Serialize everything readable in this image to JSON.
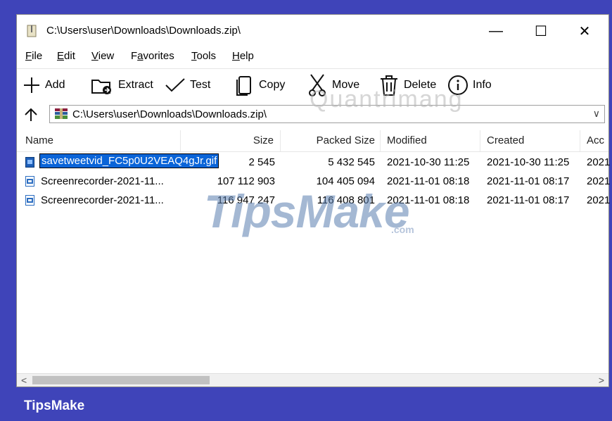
{
  "window": {
    "title": "C:\\Users\\user\\Downloads\\Downloads.zip\\",
    "minimize": "—",
    "maximize": "☐",
    "close": "✕"
  },
  "menu": [
    {
      "pre": "",
      "u": "F",
      "post": "ile"
    },
    {
      "pre": "",
      "u": "E",
      "post": "dit"
    },
    {
      "pre": "",
      "u": "V",
      "post": "iew"
    },
    {
      "pre": "F",
      "u": "a",
      "post": "vorites"
    },
    {
      "pre": "",
      "u": "T",
      "post": "ools"
    },
    {
      "pre": "",
      "u": "H",
      "post": "elp"
    }
  ],
  "toolbar": {
    "add": "Add",
    "extract": "Extract",
    "test": "Test",
    "copy": "Copy",
    "move": "Move",
    "delete": "Delete",
    "info": "Info"
  },
  "address": {
    "path": "C:\\Users\\user\\Downloads\\Downloads.zip\\",
    "chevron": "∨"
  },
  "columns": [
    "Name",
    "Size",
    "Packed Size",
    "Modified",
    "Created",
    "Acc"
  ],
  "rows": [
    {
      "name": "savetweetvid_FC5p0U2VEAQ4gJr.gif",
      "size": "2 545",
      "packed": "5 432 545",
      "modified": "2021-10-30 11:25",
      "created": "2021-10-30 11:25",
      "acc": "2021"
    },
    {
      "name": "Screenrecorder-2021-11...",
      "size": "107 112 903",
      "packed": "104 405 094",
      "modified": "2021-11-01 08:18",
      "created": "2021-11-01 08:17",
      "acc": "2021"
    },
    {
      "name": "Screenrecorder-2021-11...",
      "size": "116 947 247",
      "packed": "116 408 801",
      "modified": "2021-11-01 08:18",
      "created": "2021-11-01 08:17",
      "acc": "2021"
    }
  ],
  "scroll": {
    "left": "<",
    "right": ">"
  },
  "watermarks": {
    "main": "TipsMake",
    "dot_com": ".com",
    "top": "Quantrimang"
  },
  "brand": "TipsMake",
  "colors": {
    "background": "#3f44b9",
    "selection": "#0a64d8"
  }
}
